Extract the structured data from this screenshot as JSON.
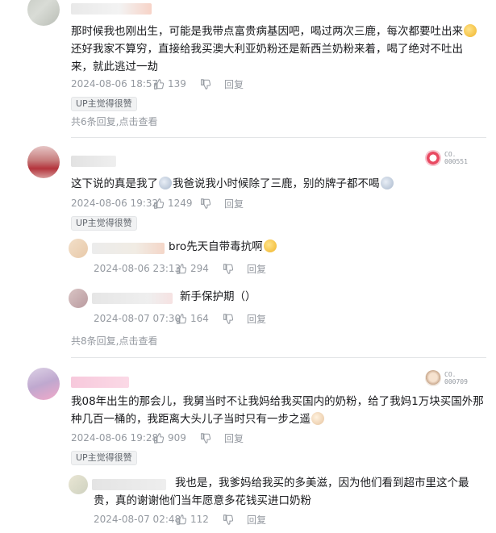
{
  "comments": [
    {
      "text": "那时候我也刚出生，可能是我带点富贵病基因吧，喝过两次三鹿，每次都要吐出来",
      "text2": "还好我家不算穷，直接给我买澳大利亚奶粉还是新西兰奶粉来着，喝了绝对不吐出来，就此逃过一劫",
      "time": "2024-08-06 18:57",
      "likes": "139",
      "reply_label": "回复",
      "up_tag": "UP主觉得很赞",
      "more_count": "共6条回复,",
      "more_link": "点击查看"
    },
    {
      "text": "这下说的真是我了",
      "text2": "我爸说我小时候除了三鹿，别的牌子都不喝",
      "time": "2024-08-06 19:32",
      "likes": "1249",
      "reply_label": "回复",
      "up_tag": "UP主觉得很赞",
      "badge": "CO.\n000551",
      "replies": [
        {
          "text": "bro先天自带毒抗啊",
          "time": "2024-08-06 23:13",
          "likes": "294",
          "reply_label": "回复"
        },
        {
          "text": "新手保护期（）",
          "time": "2024-08-07 07:30",
          "likes": "164",
          "reply_label": "回复"
        }
      ],
      "more_count": "共8条回复,",
      "more_link": "点击查看"
    },
    {
      "text": "我08年出生的那会儿，我舅当时不让我妈给我买国内的奶粉，给了我妈1万块买国外那种几百一桶的，我距离大头儿子当时只有一步之遥",
      "time": "2024-08-06 19:28",
      "likes": "909",
      "reply_label": "回复",
      "up_tag": "UP主觉得很赞",
      "badge": "CO.\n000709",
      "replies": [
        {
          "text": "我也是，我爹妈给我买的多美滋，因为他们看到超市里这个最贵，真的谢谢他们当年愿意多花钱买进口奶粉",
          "time": "2024-08-07 02:48",
          "likes": "112",
          "reply_label": "回复"
        }
      ]
    }
  ],
  "colors": {
    "meta": "#9499a0",
    "text": "#18191c",
    "divider": "#e3e5e7"
  }
}
